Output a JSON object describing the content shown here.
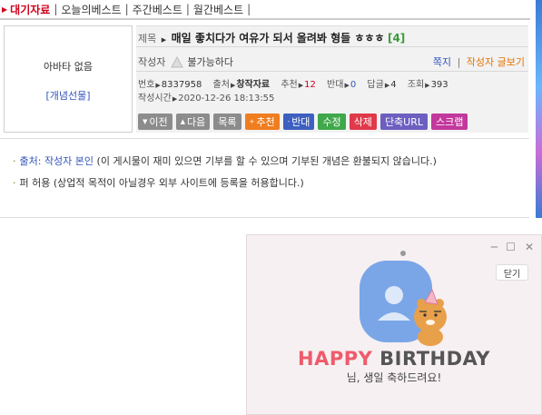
{
  "nav": {
    "active": "대기자료",
    "items": [
      "오늘의베스트",
      "주간베스트",
      "월간베스트"
    ],
    "sep": "|"
  },
  "avatar": {
    "empty_text": "아바타 없음",
    "gift_link": "[개념선물]"
  },
  "post": {
    "title_label": "제목",
    "title": "매일 좋치다가 여유가 되서 올려봐 형들 ㅎㅎㅎ",
    "comment_count": "[4]",
    "author_label": "작성자",
    "author": "불가능하다",
    "memo_link": "쪽지",
    "posts_link": "작성자 글보기",
    "stats": {
      "number_label": "번호",
      "number": "8337958",
      "source_label": "출처",
      "source": "창작자료",
      "recommend_label": "추천",
      "recommend": "12",
      "oppose_label": "반대",
      "oppose": "0",
      "reply_label": "답글",
      "reply": "4",
      "view_label": "조회",
      "view": "393"
    },
    "time_label": "작성시간",
    "time": "2020-12-26 18:13:55"
  },
  "buttons": {
    "prev": "이전",
    "next": "다음",
    "list": "목록",
    "recommend": "추천",
    "oppose": "반대",
    "edit": "수정",
    "delete": "삭제",
    "short_url": "단축URL",
    "scrap": "스크랩"
  },
  "content": {
    "source_label": "출처: 작성자 본인",
    "source_note": "(이 게시물이 재미 있으면 기부를 할 수 있으며 기부된 개념은 환불되지 않습니다.)",
    "scrap_allowed": "퍼 허용 (상업적 목적이 아닐경우 외부 사이트에 등록을 허용합니다.)"
  },
  "popup": {
    "close_label": "닫기",
    "happy": "HAPPY",
    "birthday": "BIRTHDAY",
    "message": "님, 생일 축하드려요!"
  },
  "colors": {
    "accent_red": "#d0021b",
    "link_blue": "#3355bb",
    "happy_pink": "#ee5b6b"
  }
}
